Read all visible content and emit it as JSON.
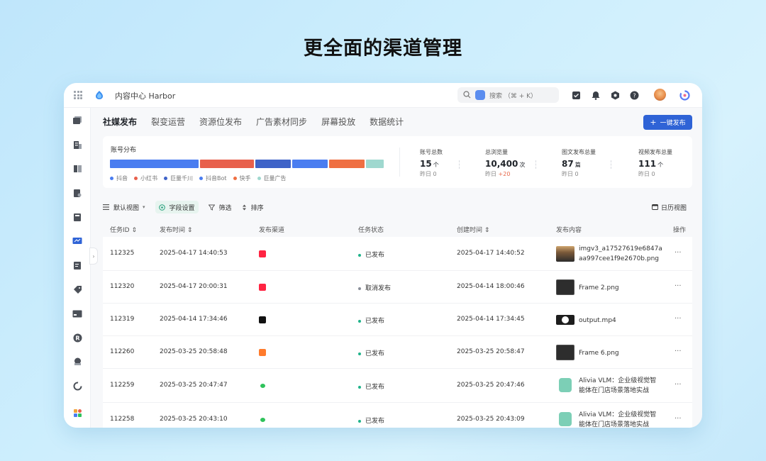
{
  "hero": {
    "title": "更全面的渠道管理"
  },
  "app": {
    "title": "内容中心 Harbor"
  },
  "search": {
    "placeholder": "搜索 （⌘ + K）"
  },
  "tabs": [
    {
      "label": "社媒发布",
      "active": true
    },
    {
      "label": "裂变运营"
    },
    {
      "label": "资源位发布"
    },
    {
      "label": "广告素材同步"
    },
    {
      "label": "屏幕投放"
    },
    {
      "label": "数据统计"
    }
  ],
  "actions": {
    "publish_label": "一键发布"
  },
  "distribution": {
    "title": "账号分布",
    "segments": [
      {
        "name": "抖音",
        "share": 0.325,
        "color": "#4a7df0"
      },
      {
        "name": "小红书",
        "share": 0.195,
        "color": "#e8604c"
      },
      {
        "name": "巨量千川",
        "share": 0.13,
        "color": "#3f63c8"
      },
      {
        "name": "抖音Bot",
        "share": 0.13,
        "color": "#4a7df0"
      },
      {
        "name": "快手",
        "share": 0.13,
        "color": "#ef6f42"
      },
      {
        "name": "巨量广告",
        "share": 0.065,
        "color": "#9fd8cf"
      }
    ]
  },
  "kpis": [
    {
      "label": "账号总数",
      "value": "15",
      "unit": "个",
      "sub_label": "昨日",
      "sub_value": "0"
    },
    {
      "label": "总浏览量",
      "value": "10,400",
      "unit": "次",
      "sub_label": "昨日",
      "sub_value": "+20"
    },
    {
      "label": "图文发布总量",
      "value": "87",
      "unit": "篇",
      "sub_label": "昨日",
      "sub_value": "0"
    },
    {
      "label": "视频发布总量",
      "value": "111",
      "unit": "个",
      "sub_label": "昨日",
      "sub_value": "0"
    }
  ],
  "toolbar": {
    "view_label": "默认视图",
    "field_label": "字段设置",
    "filter_label": "筛选",
    "sort_label": "排序",
    "calendar_label": "日历视图"
  },
  "table": {
    "headers": [
      "任务ID ⇕",
      "发布时间 ⇕",
      "发布渠道",
      "任务状态",
      "创建时间 ⇕",
      "发布内容",
      "操作"
    ],
    "rows": [
      {
        "id": "112325",
        "publish_time": "2025-04-17 14:40:53",
        "channel": "小红书",
        "channel_color": "#ff2442",
        "status": "已发布",
        "status_color": "#1fb38a",
        "created": "2025-04-17 14:40:52",
        "content_line1": "imgv3_a17527619e6847a",
        "content_line2": "aa997cee1f9e2670b.png",
        "thumb": "photo",
        "more": "···"
      },
      {
        "id": "112320",
        "publish_time": "2025-04-17 20:00:31",
        "channel": "小红书",
        "channel_color": "#ff2442",
        "status": "取消发布",
        "status_color": "#8a8f99",
        "created": "2025-04-14 18:00:46",
        "content_line1": "Frame 2.png",
        "content_line2": "",
        "thumb": "frame",
        "more": "···"
      },
      {
        "id": "112319",
        "publish_time": "2025-04-14 17:34:46",
        "channel": "抖音",
        "channel_color": "#111111",
        "status": "已发布",
        "status_color": "#1fb38a",
        "created": "2025-04-14 17:34:45",
        "content_line1": "output.mp4",
        "content_line2": "",
        "thumb": "video",
        "more": "···"
      },
      {
        "id": "112260",
        "publish_time": "2025-03-25 20:58:48",
        "channel": "快手",
        "channel_color": "#ff7b2c",
        "status": "已发布",
        "status_color": "#1fb38a",
        "created": "2025-03-25 20:58:47",
        "content_line1": "Frame 6.png",
        "content_line2": "",
        "thumb": "frame",
        "more": "···"
      },
      {
        "id": "112259",
        "publish_time": "2025-03-25 20:47:47",
        "channel": "微信",
        "channel_color": "#2fc25b",
        "status": "已发布",
        "status_color": "#1fb38a",
        "created": "2025-03-25 20:47:46",
        "content_line1": "Alivia VLM：企业级视觉智",
        "content_line2": "能体在门店场景落地实战",
        "thumb": "doc",
        "more": "···"
      },
      {
        "id": "112258",
        "publish_time": "2025-03-25 20:43:10",
        "channel": "微信",
        "channel_color": "#2fc25b",
        "status": "已发布",
        "status_color": "#1fb38a",
        "created": "2025-03-25 20:43:09",
        "content_line1": "Alivia VLM：企业级视觉智",
        "content_line2": "能体在门店场景落地实战",
        "thumb": "doc",
        "more": "···"
      }
    ]
  }
}
